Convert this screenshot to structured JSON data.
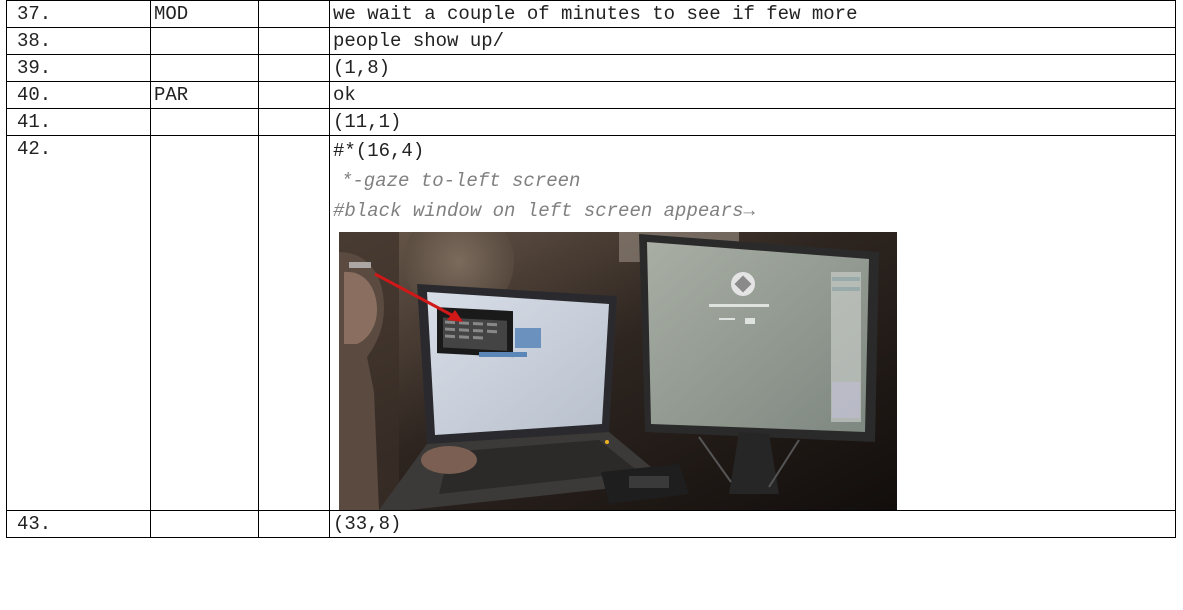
{
  "rows": [
    {
      "num": "37.",
      "speaker": "MOD",
      "text": "we wait a couple of minutes to see if few more"
    },
    {
      "num": "38.",
      "speaker": "",
      "text": "people show up/"
    },
    {
      "num": "39.",
      "speaker": "",
      "text": "(1,8)"
    },
    {
      "num": "40.",
      "speaker": "PAR",
      "text": "ok"
    },
    {
      "num": "41.",
      "speaker": "",
      "text": "(11,1)"
    },
    {
      "num": "42.",
      "speaker": "",
      "text": "#*(16,4)",
      "notes": [
        "*-gaze to-left screen",
        "#black window on left screen appears"
      ],
      "note_arrow": "→",
      "image": "video-still: participant at desk with laptop (left) showing a black window, red arrow pointing at it, and a large monitor (right)"
    },
    {
      "num": "43.",
      "speaker": "",
      "text": "(33,8)"
    }
  ],
  "colors": {
    "border": "#000000",
    "note_text": "#808080",
    "arrow": "#d01818"
  }
}
